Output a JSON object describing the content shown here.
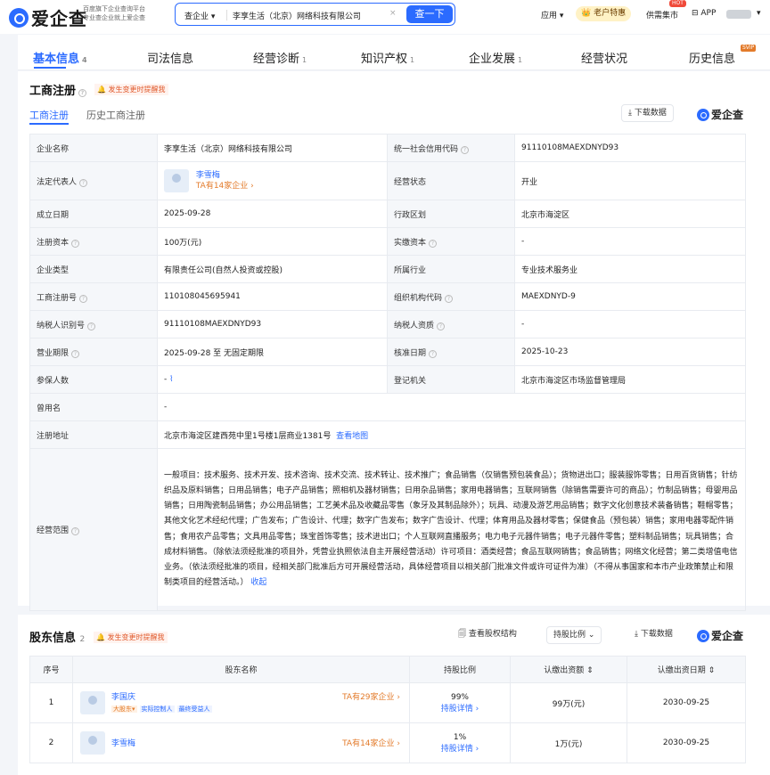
{
  "header": {
    "logo_text": "爱企查",
    "logo_sub1": "百度旗下企业查询平台",
    "logo_sub2": "专业查企业就上爱企查",
    "search_type": "查企业 ▾",
    "search_value": "李享生活（北京）网络科技有限公司",
    "search_clear": "×",
    "search_button": "查一下",
    "apps": "应用 ▾",
    "vip": "👑 老户特惠",
    "supply": "供需集市",
    "hot": "HOT",
    "app": "⊟ APP",
    "user_caret": "▾"
  },
  "nav": {
    "tabs": [
      {
        "label": "基本信息",
        "count": "4"
      },
      {
        "label": "司法信息",
        "count": ""
      },
      {
        "label": "经营诊断",
        "count": "1"
      },
      {
        "label": "知识产权",
        "count": "1"
      },
      {
        "label": "企业发展",
        "count": "1"
      },
      {
        "label": "经营状况",
        "count": ""
      },
      {
        "label": "历史信息",
        "count": ""
      }
    ],
    "svip": "SVIP"
  },
  "business": {
    "title": "工商注册",
    "alert": "🔔 发生变更时提醒我",
    "subtab_active": "工商注册",
    "subtab_other": "历史工商注册",
    "download": "⤓ 下载数据",
    "brand": "爱企查",
    "rows": [
      {
        "l1": "企业名称",
        "v1": "李享生活（北京）网络科技有限公司",
        "l2": "统一社会信用代码",
        "v2": "91110108MAEXDNYD93"
      },
      {
        "l1": "法定代表人",
        "v1": "",
        "l2": "经营状态",
        "v2": "开业"
      },
      {
        "l1": "成立日期",
        "v1": "2025-09-28",
        "l2": "行政区划",
        "v2": "北京市海淀区"
      },
      {
        "l1": "注册资本",
        "v1": "100万(元)",
        "l2": "实缴资本",
        "v2": "-"
      },
      {
        "l1": "企业类型",
        "v1": "有限责任公司(自然人投资或控股)",
        "l2": "所属行业",
        "v2": "专业技术服务业"
      },
      {
        "l1": "工商注册号",
        "v1": "110108045695941",
        "l2": "组织机构代码",
        "v2": "MAEXDNYD-9"
      },
      {
        "l1": "纳税人识别号",
        "v1": "91110108MAEXDNYD93",
        "l2": "纳税人资质",
        "v2": "-"
      },
      {
        "l1": "营业期限",
        "v1": "2025-09-28 至 无固定期限",
        "l2": "核准日期",
        "v2": "2025-10-23"
      },
      {
        "l1": "参保人数",
        "v1": "-",
        "l2": "登记机关",
        "v2": "北京市海淀区市场监督管理局"
      }
    ],
    "legal_rep": {
      "name": "李雪梅",
      "link": "TA有14家企业 ›"
    },
    "insured_icon": "⌇",
    "former_name_label": "曾用名",
    "former_name": "-",
    "address_label": "注册地址",
    "address": "北京市海淀区建西苑中里1号楼1层商业1381号",
    "map_link": "查看地图",
    "scope_label": "经营范围",
    "scope": "一般项目：技术服务、技术开发、技术咨询、技术交流、技术转让、技术推广；食品销售（仅销售预包装食品）；货物进出口；服装服饰零售；日用百货销售；针纺织品及原料销售；日用品销售；电子产品销售；照相机及器材销售；日用杂品销售；家用电器销售；互联网销售（除销售需要许可的商品）；竹制品销售；母婴用品销售；日用陶瓷制品销售；办公用品销售；工艺美术品及收藏品零售（象牙及其制品除外）；玩具、动漫及游艺用品销售；数字文化创意技术装备销售；鞋帽零售；其他文化艺术经纪代理；广告发布；广告设计、代理；数字广告发布；数字广告设计、代理；体育用品及器材零售；保健食品（预包装）销售；家用电器零配件销售；食用农产品零售；文具用品零售；珠宝首饰零售；技术进出口；个人互联网直播服务；电力电子元器件销售；电子元器件零售；塑料制品销售；玩具销售；合成材料销售。（除依法须经批准的项目外，凭营业执照依法自主开展经营活动）许可项目：酒类经营；食品互联网销售；食品销售；网络文化经营；第二类增值电信业务。（依法须经批准的项目，经相关部门批准后方可开展经营活动，具体经营项目以相关部门批准文件或许可证件为准）（不得从事国家和本市产业政策禁止和限制类项目的经营活动。）",
    "collapse": "收起"
  },
  "shareholders": {
    "title": "股东信息",
    "count": "2",
    "alert": "🔔 发生变更时提醒我",
    "equity_btn": "🗐 查看股权结构",
    "ratio_btn": "持股比例 ⌄",
    "download": "⤓ 下载数据",
    "brand": "爱企查",
    "headers": [
      "序号",
      "股东名称",
      "持股比例",
      "认缴出资额 ⇕",
      "认缴出资日期 ⇕"
    ],
    "rows": [
      {
        "no": "1",
        "name": "李国庆",
        "tags": [
          "大股东▾",
          "实际控制人",
          "最终受益人"
        ],
        "link": "TA有29家企业 ›",
        "ratio": "99%",
        "detail": "持股详情 ›",
        "amount": "99万(元)",
        "date": "2030-09-25"
      },
      {
        "no": "2",
        "name": "李雪梅",
        "tags": [],
        "link": "TA有14家企业 ›",
        "ratio": "1%",
        "detail": "持股详情 ›",
        "amount": "1万(元)",
        "date": "2030-09-25"
      }
    ]
  },
  "colors": {
    "accent": "#2b6bff",
    "warn": "#e37b2b"
  }
}
